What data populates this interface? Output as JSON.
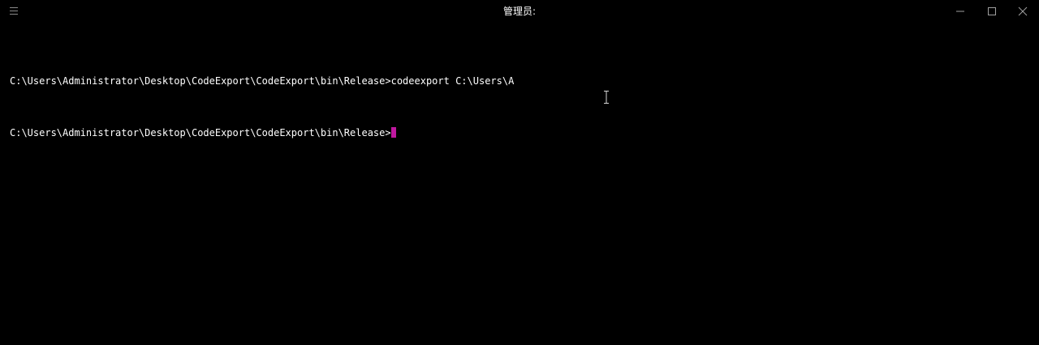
{
  "window": {
    "title": "管理员:",
    "icons": {
      "menu": "hamburger-menu-icon",
      "minimize": "minimize-icon",
      "maximize": "maximize-icon",
      "close": "close-icon"
    }
  },
  "console": {
    "lines": [
      "C:\\Users\\Administrator\\Desktop\\CodeExport\\CodeExport\\bin\\Release>codeexport C:\\Users\\A",
      "C:\\Users\\Administrator\\Desktop\\CodeExport\\CodeExport\\bin\\Release>"
    ],
    "text_color": "#ffffff",
    "cursor_color": "#c0189f",
    "background_color": "#000000"
  },
  "mouse_pointer": "text-ibeam-cursor"
}
